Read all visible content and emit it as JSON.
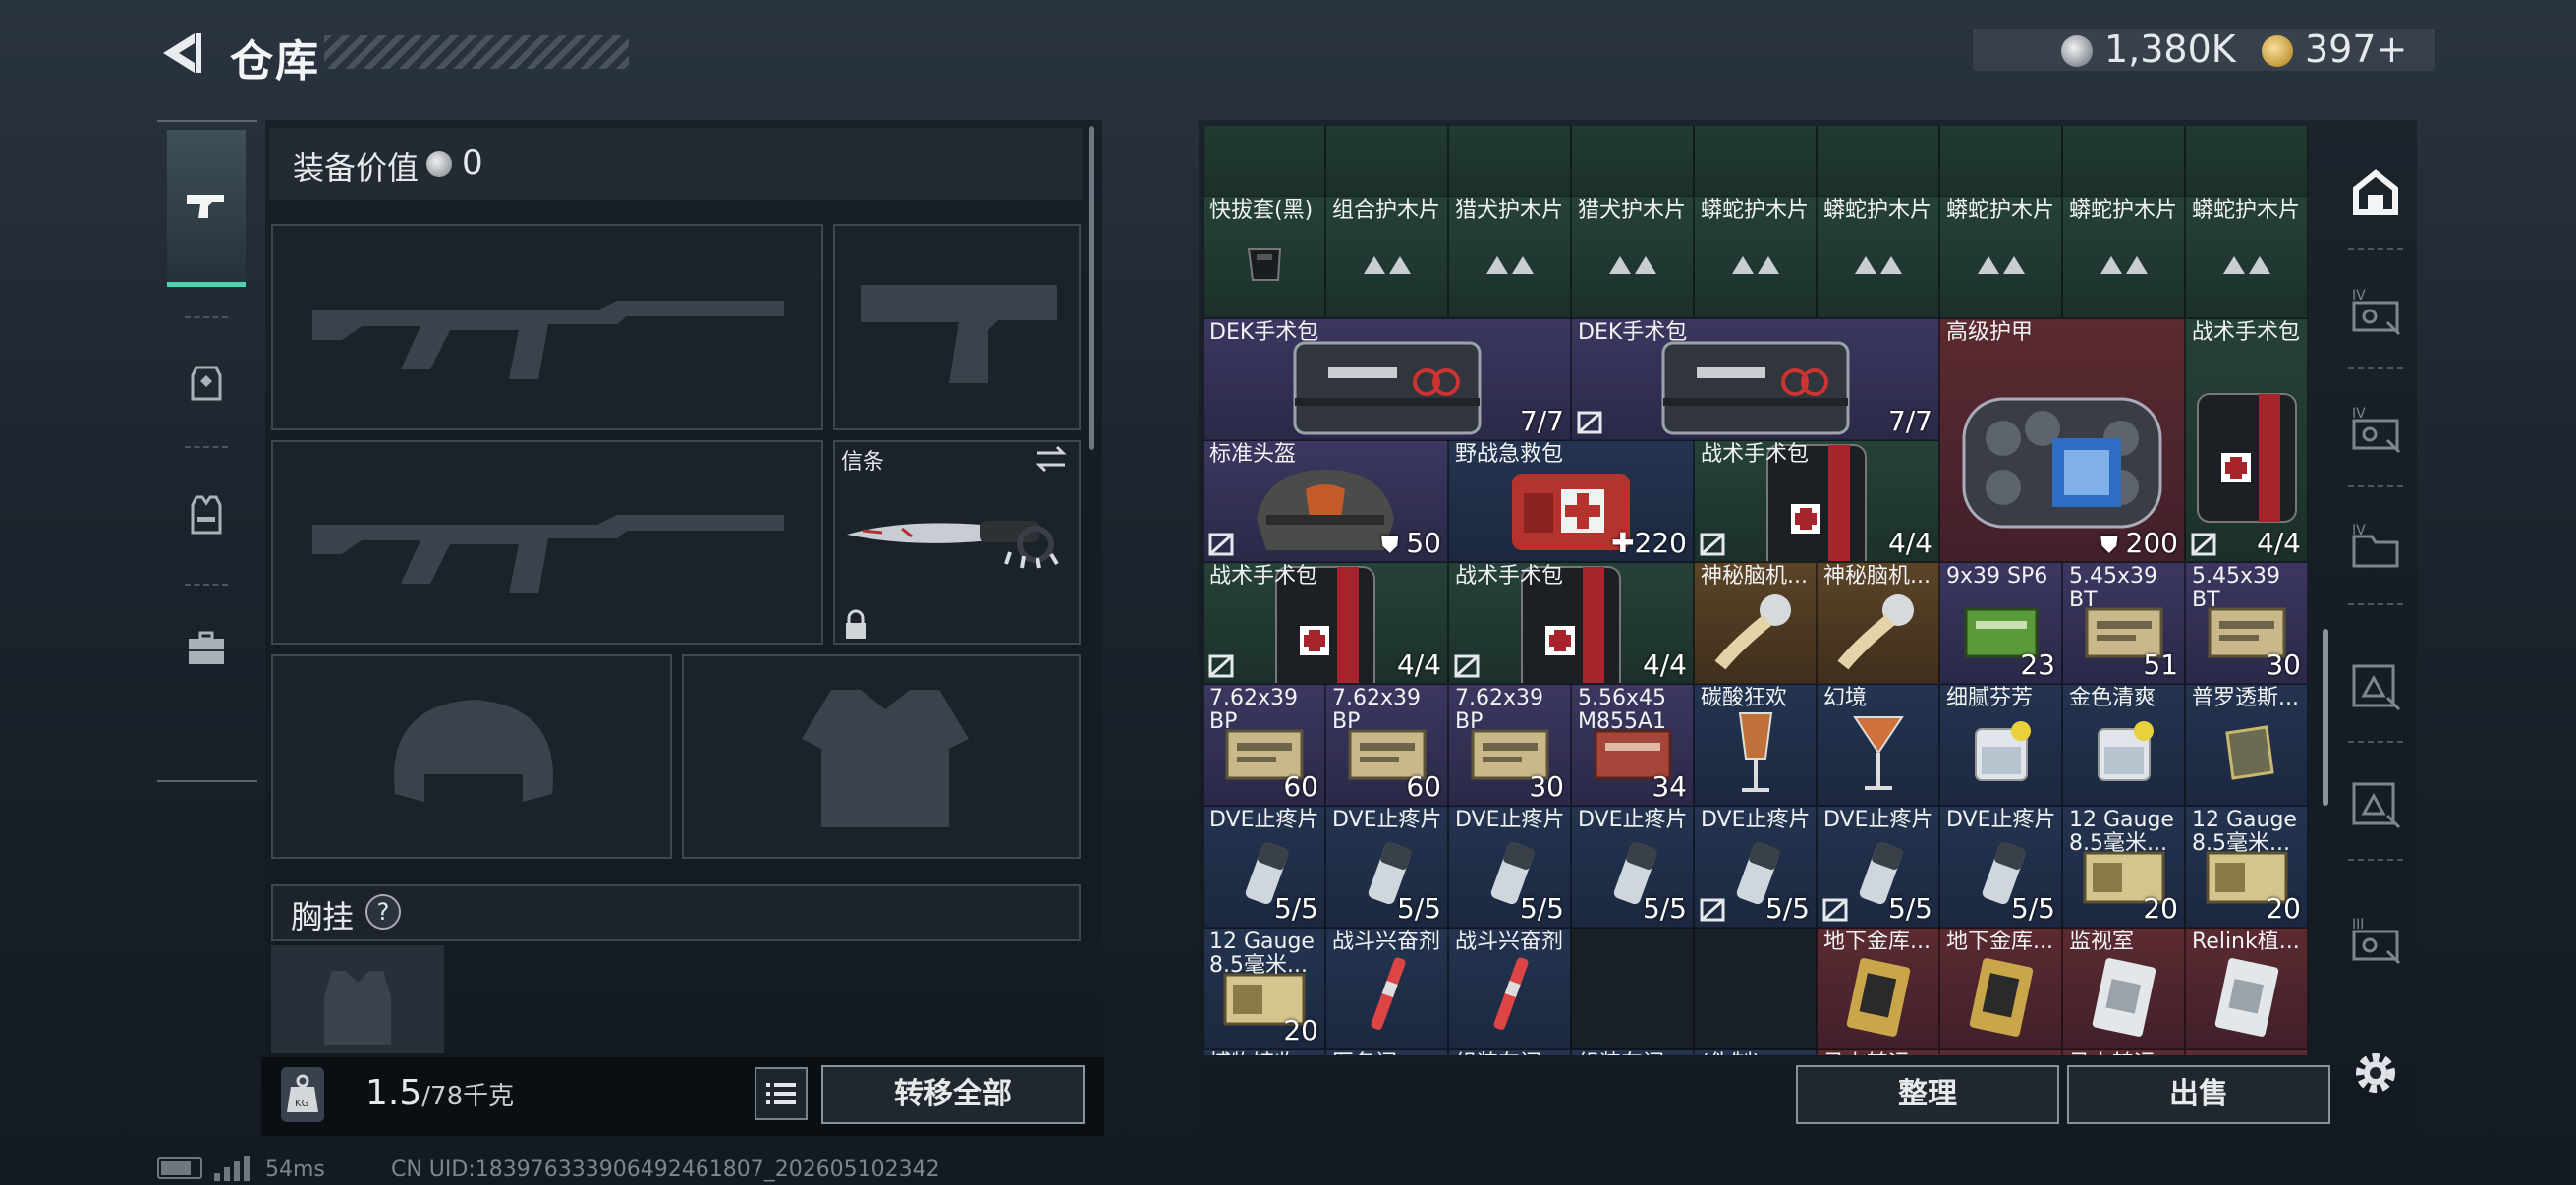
{
  "header": {
    "title": "仓库",
    "silver": "1,380K",
    "gold": "397+"
  },
  "loadout": {
    "equip_value_label": "装备价值",
    "equip_value": "0",
    "knife_label": "信条",
    "vest_label": "胸挂",
    "help": "?"
  },
  "footer": {
    "weight": "1.5",
    "weight_unit": "/78千克",
    "transfer_all": "转移全部",
    "sort": "整理",
    "sell": "出售"
  },
  "status": {
    "ping": "54ms",
    "uid": "CN UID:183976333906492461807_202605102342"
  },
  "colors": {
    "accent": "#4bd6b0",
    "purple": "#3a3658",
    "green": "#243a32",
    "red": "#5a2a30",
    "blue": "#22314a",
    "gold": "#5a4226"
  },
  "inventory": {
    "cells": [
      {
        "name": "",
        "count": "",
        "c": 0,
        "r": 0,
        "w": 1,
        "h": 1,
        "color": "green"
      },
      {
        "name": "",
        "count": "",
        "c": 1,
        "r": 0,
        "w": 1,
        "h": 1,
        "color": "green"
      },
      {
        "name": "",
        "count": "",
        "c": 2,
        "r": 0,
        "w": 1,
        "h": 1,
        "color": "green"
      },
      {
        "name": "",
        "count": "",
        "c": 3,
        "r": 0,
        "w": 1,
        "h": 1,
        "color": "green"
      },
      {
        "name": "",
        "count": "",
        "c": 4,
        "r": 0,
        "w": 1,
        "h": 1,
        "color": "green"
      },
      {
        "name": "",
        "count": "",
        "c": 5,
        "r": 0,
        "w": 1,
        "h": 1,
        "color": "green"
      },
      {
        "name": "",
        "count": "",
        "c": 6,
        "r": 0,
        "w": 1,
        "h": 1,
        "color": "green"
      },
      {
        "name": "",
        "count": "",
        "c": 7,
        "r": 0,
        "w": 1,
        "h": 1,
        "color": "green"
      },
      {
        "name": "",
        "count": "",
        "c": 8,
        "r": 0,
        "w": 1,
        "h": 1,
        "color": "green"
      },
      {
        "name": "快拔套(黑)",
        "count": "",
        "c": 0,
        "r": 1,
        "w": 1,
        "h": 1,
        "color": "green",
        "art": "holster"
      },
      {
        "name": "组合护木片",
        "count": "",
        "c": 1,
        "r": 1,
        "w": 1,
        "h": 1,
        "color": "green",
        "art": "tri"
      },
      {
        "name": "猎犬护木片",
        "count": "",
        "c": 2,
        "r": 1,
        "w": 1,
        "h": 1,
        "color": "green",
        "art": "tri"
      },
      {
        "name": "猎犬护木片",
        "count": "",
        "c": 3,
        "r": 1,
        "w": 1,
        "h": 1,
        "color": "green",
        "art": "tri"
      },
      {
        "name": "蟒蛇护木片",
        "count": "",
        "c": 4,
        "r": 1,
        "w": 1,
        "h": 1,
        "color": "green",
        "art": "tri"
      },
      {
        "name": "蟒蛇护木片",
        "count": "",
        "c": 5,
        "r": 1,
        "w": 1,
        "h": 1,
        "color": "green",
        "art": "tri"
      },
      {
        "name": "蟒蛇护木片",
        "count": "",
        "c": 6,
        "r": 1,
        "w": 1,
        "h": 1,
        "color": "green",
        "art": "tri"
      },
      {
        "name": "蟒蛇护木片",
        "count": "",
        "c": 7,
        "r": 1,
        "w": 1,
        "h": 1,
        "color": "green",
        "art": "tri"
      },
      {
        "name": "蟒蛇护木片",
        "count": "",
        "c": 8,
        "r": 1,
        "w": 1,
        "h": 1,
        "color": "green",
        "art": "tri"
      },
      {
        "name": "DEK手术包",
        "count": "7/7",
        "c": 0,
        "r": 2,
        "w": 3,
        "h": 1,
        "color": "purple",
        "art": "dek"
      },
      {
        "name": "DEK手术包",
        "count": "7/7",
        "c": 3,
        "r": 2,
        "w": 3,
        "h": 1,
        "color": "purple",
        "art": "dek",
        "mark": true
      },
      {
        "name": "高级护甲",
        "count": "200",
        "c": 6,
        "r": 2,
        "w": 2,
        "h": 2,
        "color": "red",
        "art": "armor",
        "shield": true
      },
      {
        "name": "战术手术包",
        "count": "4/4",
        "c": 8,
        "r": 2,
        "w": 1,
        "h": 2,
        "color": "green",
        "art": "tac",
        "mark": true
      },
      {
        "name": "标准头盔",
        "count": "50",
        "c": 0,
        "r": 3,
        "w": 2,
        "h": 1,
        "color": "purple",
        "art": "helmet",
        "mark": true,
        "shield": true
      },
      {
        "name": "野战急救包",
        "count": "220",
        "c": 2,
        "r": 3,
        "w": 2,
        "h": 1,
        "color": "blue",
        "art": "medkit",
        "plus": true
      },
      {
        "name": "战术手术包",
        "count": "4/4",
        "c": 4,
        "r": 3,
        "w": 2,
        "h": 1,
        "color": "green",
        "art": "tac",
        "mark": true
      },
      {
        "name": "战术手术包",
        "count": "4/4",
        "c": 0,
        "r": 4,
        "w": 2,
        "h": 1,
        "color": "green",
        "art": "tac",
        "mark": true
      },
      {
        "name": "战术手术包",
        "count": "4/4",
        "c": 2,
        "r": 4,
        "w": 2,
        "h": 1,
        "color": "green",
        "art": "tac",
        "mark": true
      },
      {
        "name": "神秘脑机...",
        "count": "",
        "c": 4,
        "r": 4,
        "w": 1,
        "h": 1,
        "color": "gold",
        "art": "brain"
      },
      {
        "name": "神秘脑机...",
        "count": "",
        "c": 5,
        "r": 4,
        "w": 1,
        "h": 1,
        "color": "gold",
        "art": "brain"
      },
      {
        "name": "9x39 SP6",
        "count": "23",
        "c": 6,
        "r": 4,
        "w": 1,
        "h": 1,
        "color": "purple",
        "art": "ammo-green"
      },
      {
        "name": "5.45x39 BT",
        "count": "51",
        "c": 7,
        "r": 4,
        "w": 1,
        "h": 1,
        "color": "purple",
        "art": "ammo-box"
      },
      {
        "name": "5.45x39 BT",
        "count": "30",
        "c": 8,
        "r": 4,
        "w": 1,
        "h": 1,
        "color": "purple",
        "art": "ammo-box"
      },
      {
        "name": "7.62x39 BP",
        "count": "60",
        "c": 0,
        "r": 5,
        "w": 1,
        "h": 1,
        "color": "purple",
        "art": "ammo-box"
      },
      {
        "name": "7.62x39 BP",
        "count": "60",
        "c": 1,
        "r": 5,
        "w": 1,
        "h": 1,
        "color": "purple",
        "art": "ammo-box"
      },
      {
        "name": "7.62x39 BP",
        "count": "30",
        "c": 2,
        "r": 5,
        "w": 1,
        "h": 1,
        "color": "purple",
        "art": "ammo-box"
      },
      {
        "name": "5.56x45 M855A1",
        "count": "34",
        "c": 3,
        "r": 5,
        "w": 1,
        "h": 1,
        "color": "purple",
        "art": "ammo-red"
      },
      {
        "name": "碳酸狂欢",
        "count": "",
        "c": 4,
        "r": 5,
        "w": 1,
        "h": 1,
        "color": "blue",
        "art": "glass"
      },
      {
        "name": "幻境",
        "count": "",
        "c": 5,
        "r": 5,
        "w": 1,
        "h": 1,
        "color": "blue",
        "art": "cocktail"
      },
      {
        "name": "细腻芬芳",
        "count": "",
        "c": 6,
        "r": 5,
        "w": 1,
        "h": 1,
        "color": "blue",
        "art": "tumbler"
      },
      {
        "name": "金色清爽",
        "count": "",
        "c": 7,
        "r": 5,
        "w": 1,
        "h": 1,
        "color": "blue",
        "art": "tumbler"
      },
      {
        "name": "普罗透斯...",
        "count": "",
        "c": 8,
        "r": 5,
        "w": 1,
        "h": 1,
        "color": "blue",
        "art": "pouch"
      },
      {
        "name": "DVE止疼片",
        "count": "5/5",
        "c": 0,
        "r": 6,
        "w": 1,
        "h": 1,
        "color": "blue",
        "art": "pill"
      },
      {
        "name": "DVE止疼片",
        "count": "5/5",
        "c": 1,
        "r": 6,
        "w": 1,
        "h": 1,
        "color": "blue",
        "art": "pill"
      },
      {
        "name": "DVE止疼片",
        "count": "5/5",
        "c": 2,
        "r": 6,
        "w": 1,
        "h": 1,
        "color": "blue",
        "art": "pill"
      },
      {
        "name": "DVE止疼片",
        "count": "5/5",
        "c": 3,
        "r": 6,
        "w": 1,
        "h": 1,
        "color": "blue",
        "art": "pill"
      },
      {
        "name": "DVE止疼片",
        "count": "5/5",
        "c": 4,
        "r": 6,
        "w": 1,
        "h": 1,
        "color": "blue",
        "art": "pill",
        "mark": true
      },
      {
        "name": "DVE止疼片",
        "count": "5/5",
        "c": 5,
        "r": 6,
        "w": 1,
        "h": 1,
        "color": "blue",
        "art": "pill",
        "mark": true
      },
      {
        "name": "DVE止疼片",
        "count": "5/5",
        "c": 6,
        "r": 6,
        "w": 1,
        "h": 1,
        "color": "blue",
        "art": "pill"
      },
      {
        "name": "12 Gauge 8.5毫米...",
        "count": "20",
        "c": 7,
        "r": 6,
        "w": 1,
        "h": 1,
        "color": "blue",
        "art": "shell"
      },
      {
        "name": "12 Gauge 8.5毫米...",
        "count": "20",
        "c": 8,
        "r": 6,
        "w": 1,
        "h": 1,
        "color": "blue",
        "art": "shell"
      },
      {
        "name": "12 Gauge 8.5毫米...",
        "count": "20",
        "c": 0,
        "r": 7,
        "w": 1,
        "h": 1,
        "color": "blue",
        "art": "shell"
      },
      {
        "name": "战斗兴奋剂",
        "count": "",
        "c": 1,
        "r": 7,
        "w": 1,
        "h": 1,
        "color": "blue",
        "art": "syringe"
      },
      {
        "name": "战斗兴奋剂",
        "count": "",
        "c": 2,
        "r": 7,
        "w": 1,
        "h": 1,
        "color": "blue",
        "art": "syringe"
      },
      {
        "name": "",
        "count": "",
        "c": 3,
        "r": 7,
        "w": 1,
        "h": 1,
        "color": "empty"
      },
      {
        "name": "",
        "count": "",
        "c": 4,
        "r": 7,
        "w": 1,
        "h": 1,
        "color": "empty"
      },
      {
        "name": "地下金库...",
        "count": "",
        "c": 5,
        "r": 7,
        "w": 1,
        "h": 1,
        "color": "red",
        "art": "card"
      },
      {
        "name": "地下金库...",
        "count": "",
        "c": 6,
        "r": 7,
        "w": 1,
        "h": 1,
        "color": "red",
        "art": "card"
      },
      {
        "name": "监视室",
        "count": "",
        "c": 7,
        "r": 7,
        "w": 1,
        "h": 1,
        "color": "red",
        "art": "card2"
      },
      {
        "name": "Relink植...",
        "count": "",
        "c": 8,
        "r": 7,
        "w": 1,
        "h": 1,
        "color": "red",
        "art": "card2"
      },
      {
        "name": "博物馆收...",
        "count": "",
        "c": 0,
        "r": 8,
        "w": 1,
        "h": 1,
        "color": "blue"
      },
      {
        "name": "医务间...",
        "count": "",
        "c": 1,
        "r": 8,
        "w": 1,
        "h": 1,
        "color": "blue"
      },
      {
        "name": "组装车间...",
        "count": "",
        "c": 2,
        "r": 8,
        "w": 1,
        "h": 1,
        "color": "blue"
      },
      {
        "name": "组装车间...",
        "count": "",
        "c": 3,
        "r": 8,
        "w": 1,
        "h": 1,
        "color": "blue"
      },
      {
        "name": "(伪制)...",
        "count": "",
        "c": 4,
        "r": 8,
        "w": 1,
        "h": 1,
        "color": "blue"
      },
      {
        "name": "马上转运...",
        "count": "",
        "c": 5,
        "r": 8,
        "w": 1,
        "h": 1,
        "color": "red"
      },
      {
        "name": "",
        "count": "",
        "c": 6,
        "r": 8,
        "w": 1,
        "h": 1,
        "color": "red"
      },
      {
        "name": "马上转运...",
        "count": "",
        "c": 7,
        "r": 8,
        "w": 1,
        "h": 1,
        "color": "red"
      },
      {
        "name": "",
        "count": "",
        "c": 8,
        "r": 8,
        "w": 1,
        "h": 1,
        "color": "red"
      }
    ]
  },
  "right_tabs": [
    {
      "name": "tab-storage",
      "icon": "storage-icon",
      "label": ""
    },
    {
      "name": "tab-iv-1",
      "icon": "container-icon",
      "label": "IV"
    },
    {
      "name": "tab-iv-2",
      "icon": "container-icon",
      "label": "IV"
    },
    {
      "name": "tab-iv-3",
      "icon": "folder-icon",
      "label": "IV"
    },
    {
      "name": "tab-cert-1",
      "icon": "cert-icon",
      "label": ""
    },
    {
      "name": "tab-cert-2",
      "icon": "cert-icon",
      "label": ""
    },
    {
      "name": "tab-iii",
      "icon": "container-icon",
      "label": "III"
    }
  ]
}
